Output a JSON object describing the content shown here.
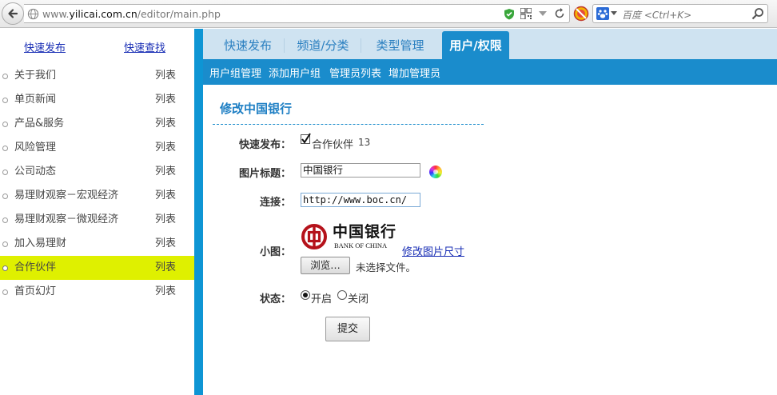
{
  "browser": {
    "url_prefix": "www.",
    "url_domain": "yilicai.com.cn",
    "url_path": "/editor/main.php",
    "search_placeholder": "百度 <Ctrl+K>"
  },
  "sidebar": {
    "quick_publish": "快速发布",
    "quick_search": "快速查找",
    "items": [
      {
        "label": "关于我们",
        "action": "列表"
      },
      {
        "label": "单页新闻",
        "action": "列表"
      },
      {
        "label": "产品&服务",
        "action": "列表"
      },
      {
        "label": "风险管理",
        "action": "列表"
      },
      {
        "label": "公司动态",
        "action": "列表"
      },
      {
        "label": "易理财观察－宏观经济",
        "action": "列表"
      },
      {
        "label": "易理财观察－微观经济",
        "action": "列表"
      },
      {
        "label": "加入易理财",
        "action": "列表"
      },
      {
        "label": "合作伙伴",
        "action": "列表"
      },
      {
        "label": "首页幻灯",
        "action": "列表"
      }
    ]
  },
  "tabs": [
    {
      "label": "快速发布"
    },
    {
      "label": "频道/分类"
    },
    {
      "label": "类型管理"
    },
    {
      "label": "用户/权限"
    }
  ],
  "subnav": [
    "用户组管理",
    "添加用户组",
    "管理员列表",
    "增加管理员"
  ],
  "form": {
    "title": "修改中国银行",
    "quick_publish_label": "快速发布：",
    "quick_publish_option": "合作伙伴",
    "quick_publish_count": "13",
    "image_title_label": "图片标题：",
    "image_title_value": "中国银行",
    "link_label": "连接：",
    "link_value": "http://www.boc.cn/",
    "thumb_label": "小图：",
    "logo_cn": "中国银行",
    "logo_en": "BANK OF CHINA",
    "resize_link": "修改图片尺寸",
    "browse_button": "浏览…",
    "no_file": "未选择文件。",
    "status_label": "状态：",
    "status_on": "开启",
    "status_off": "关闭",
    "submit": "提交"
  }
}
